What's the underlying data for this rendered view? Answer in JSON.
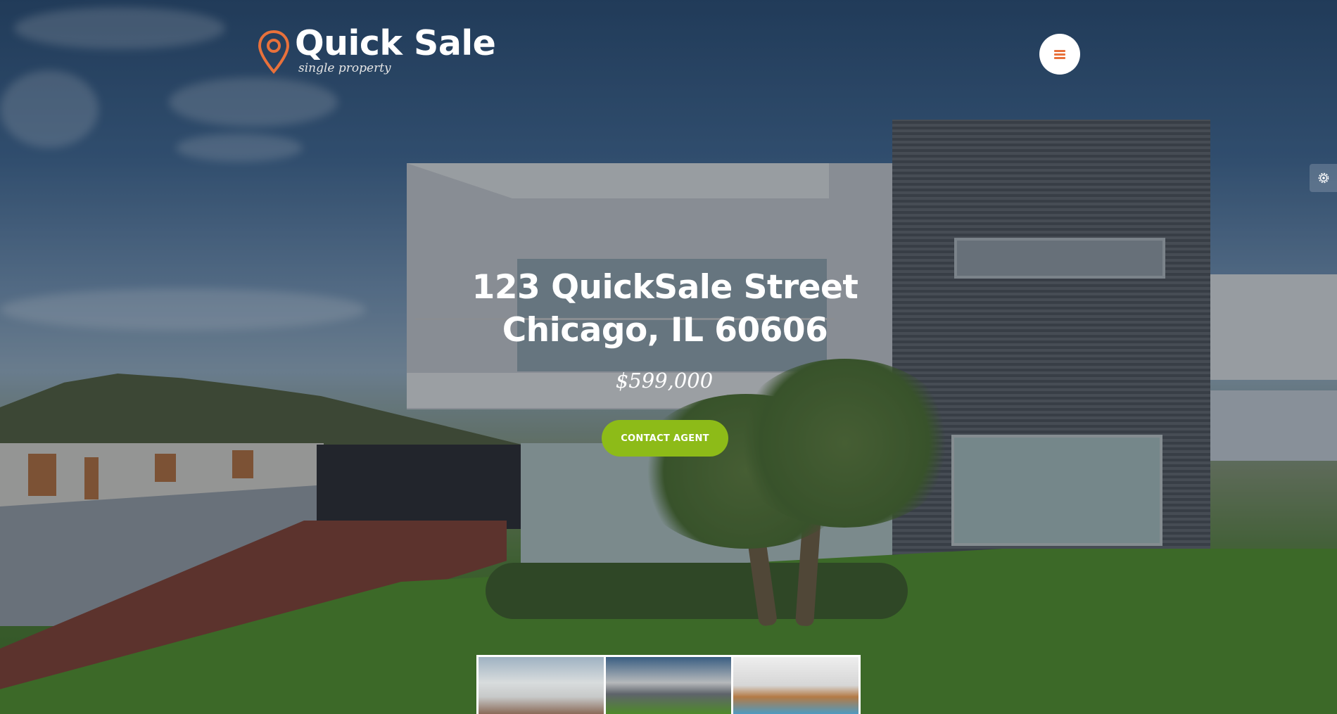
{
  "logo": {
    "title": "Quick Sale",
    "subtitle": "single property",
    "pin_color": "#e8713b"
  },
  "menu_button": {
    "icon": "hamburger-icon",
    "icon_color": "#e8713b"
  },
  "settings": {
    "icon": "gear-icon"
  },
  "property": {
    "address_line1": "123 QuickSale Street",
    "address_line2": "Chicago, IL 60606",
    "price": "$599,000"
  },
  "cta": {
    "label": "CONTACT AGENT",
    "color": "#8dbb18"
  },
  "gallery": {
    "thumbnails": [
      {
        "name": "house-front-view"
      },
      {
        "name": "house-side-view"
      },
      {
        "name": "pool-view"
      }
    ]
  }
}
